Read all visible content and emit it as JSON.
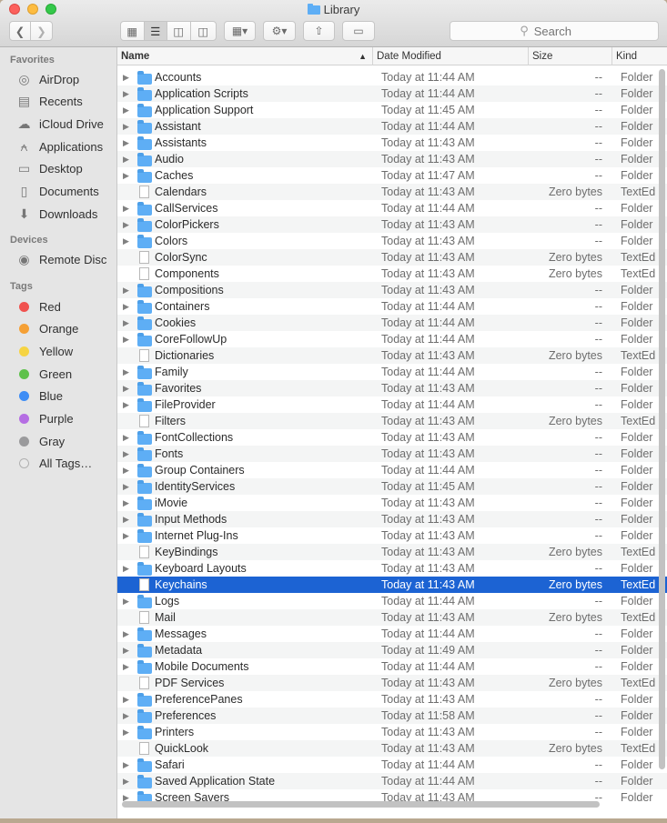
{
  "window": {
    "title": "Library"
  },
  "toolbar": {
    "view_icons": [
      "icon-view-icon",
      "list-view-icon",
      "column-view-icon",
      "cover-flow-icon"
    ],
    "search_placeholder": "Search"
  },
  "sidebar": {
    "favorites_header": "Favorites",
    "favorites": [
      {
        "label": "AirDrop",
        "icon": "airdrop-icon",
        "glyph": "◎"
      },
      {
        "label": "Recents",
        "icon": "recents-icon",
        "glyph": "▤"
      },
      {
        "label": "iCloud Drive",
        "icon": "cloud-icon",
        "glyph": "☁"
      },
      {
        "label": "Applications",
        "icon": "applications-icon",
        "glyph": "⍲"
      },
      {
        "label": "Desktop",
        "icon": "desktop-icon",
        "glyph": "▭"
      },
      {
        "label": "Documents",
        "icon": "documents-icon",
        "glyph": "▯"
      },
      {
        "label": "Downloads",
        "icon": "downloads-icon",
        "glyph": "⬇"
      }
    ],
    "devices_header": "Devices",
    "devices": [
      {
        "label": "Remote Disc",
        "icon": "disc-icon",
        "glyph": "◉"
      }
    ],
    "tags_header": "Tags",
    "tags": [
      {
        "label": "Red",
        "color": "#f0524f"
      },
      {
        "label": "Orange",
        "color": "#f5a035"
      },
      {
        "label": "Yellow",
        "color": "#f6d443"
      },
      {
        "label": "Green",
        "color": "#5ec14b"
      },
      {
        "label": "Blue",
        "color": "#3e8df5"
      },
      {
        "label": "Purple",
        "color": "#b56ee3"
      },
      {
        "label": "Gray",
        "color": "#9a9a9c"
      },
      {
        "label": "All Tags…",
        "color": "#e8e8e8"
      }
    ]
  },
  "columns": {
    "name": "Name",
    "date": "Date Modified",
    "size": "Size",
    "kind": "Kind"
  },
  "files": [
    {
      "name": "Accounts",
      "date": "Today at 11:44 AM",
      "size": "--",
      "kind": "Folder",
      "type": "folder"
    },
    {
      "name": "Application Scripts",
      "date": "Today at 11:44 AM",
      "size": "--",
      "kind": "Folder",
      "type": "folder"
    },
    {
      "name": "Application Support",
      "date": "Today at 11:45 AM",
      "size": "--",
      "kind": "Folder",
      "type": "folder"
    },
    {
      "name": "Assistant",
      "date": "Today at 11:44 AM",
      "size": "--",
      "kind": "Folder",
      "type": "folder"
    },
    {
      "name": "Assistants",
      "date": "Today at 11:43 AM",
      "size": "--",
      "kind": "Folder",
      "type": "folder"
    },
    {
      "name": "Audio",
      "date": "Today at 11:43 AM",
      "size": "--",
      "kind": "Folder",
      "type": "folder"
    },
    {
      "name": "Caches",
      "date": "Today at 11:47 AM",
      "size": "--",
      "kind": "Folder",
      "type": "folder"
    },
    {
      "name": "Calendars",
      "date": "Today at 11:43 AM",
      "size": "Zero bytes",
      "kind": "TextEd",
      "type": "doc"
    },
    {
      "name": "CallServices",
      "date": "Today at 11:44 AM",
      "size": "--",
      "kind": "Folder",
      "type": "folder"
    },
    {
      "name": "ColorPickers",
      "date": "Today at 11:43 AM",
      "size": "--",
      "kind": "Folder",
      "type": "folder"
    },
    {
      "name": "Colors",
      "date": "Today at 11:43 AM",
      "size": "--",
      "kind": "Folder",
      "type": "folder"
    },
    {
      "name": "ColorSync",
      "date": "Today at 11:43 AM",
      "size": "Zero bytes",
      "kind": "TextEd",
      "type": "doc"
    },
    {
      "name": "Components",
      "date": "Today at 11:43 AM",
      "size": "Zero bytes",
      "kind": "TextEd",
      "type": "doc"
    },
    {
      "name": "Compositions",
      "date": "Today at 11:43 AM",
      "size": "--",
      "kind": "Folder",
      "type": "folder"
    },
    {
      "name": "Containers",
      "date": "Today at 11:44 AM",
      "size": "--",
      "kind": "Folder",
      "type": "folder"
    },
    {
      "name": "Cookies",
      "date": "Today at 11:44 AM",
      "size": "--",
      "kind": "Folder",
      "type": "folder"
    },
    {
      "name": "CoreFollowUp",
      "date": "Today at 11:44 AM",
      "size": "--",
      "kind": "Folder",
      "type": "folder"
    },
    {
      "name": "Dictionaries",
      "date": "Today at 11:43 AM",
      "size": "Zero bytes",
      "kind": "TextEd",
      "type": "doc"
    },
    {
      "name": "Family",
      "date": "Today at 11:44 AM",
      "size": "--",
      "kind": "Folder",
      "type": "folder"
    },
    {
      "name": "Favorites",
      "date": "Today at 11:43 AM",
      "size": "--",
      "kind": "Folder",
      "type": "folder"
    },
    {
      "name": "FileProvider",
      "date": "Today at 11:44 AM",
      "size": "--",
      "kind": "Folder",
      "type": "folder"
    },
    {
      "name": "Filters",
      "date": "Today at 11:43 AM",
      "size": "Zero bytes",
      "kind": "TextEd",
      "type": "doc"
    },
    {
      "name": "FontCollections",
      "date": "Today at 11:43 AM",
      "size": "--",
      "kind": "Folder",
      "type": "folder"
    },
    {
      "name": "Fonts",
      "date": "Today at 11:43 AM",
      "size": "--",
      "kind": "Folder",
      "type": "folder"
    },
    {
      "name": "Group Containers",
      "date": "Today at 11:44 AM",
      "size": "--",
      "kind": "Folder",
      "type": "folder"
    },
    {
      "name": "IdentityServices",
      "date": "Today at 11:45 AM",
      "size": "--",
      "kind": "Folder",
      "type": "folder"
    },
    {
      "name": "iMovie",
      "date": "Today at 11:43 AM",
      "size": "--",
      "kind": "Folder",
      "type": "folder"
    },
    {
      "name": "Input Methods",
      "date": "Today at 11:43 AM",
      "size": "--",
      "kind": "Folder",
      "type": "folder"
    },
    {
      "name": "Internet Plug-Ins",
      "date": "Today at 11:43 AM",
      "size": "--",
      "kind": "Folder",
      "type": "folder"
    },
    {
      "name": "KeyBindings",
      "date": "Today at 11:43 AM",
      "size": "Zero bytes",
      "kind": "TextEd",
      "type": "doc"
    },
    {
      "name": "Keyboard Layouts",
      "date": "Today at 11:43 AM",
      "size": "--",
      "kind": "Folder",
      "type": "folder"
    },
    {
      "name": "Keychains",
      "date": "Today at 11:43 AM",
      "size": "Zero bytes",
      "kind": "TextEd",
      "type": "doc",
      "selected": true
    },
    {
      "name": "Logs",
      "date": "Today at 11:44 AM",
      "size": "--",
      "kind": "Folder",
      "type": "folder"
    },
    {
      "name": "Mail",
      "date": "Today at 11:43 AM",
      "size": "Zero bytes",
      "kind": "TextEd",
      "type": "doc"
    },
    {
      "name": "Messages",
      "date": "Today at 11:44 AM",
      "size": "--",
      "kind": "Folder",
      "type": "folder"
    },
    {
      "name": "Metadata",
      "date": "Today at 11:49 AM",
      "size": "--",
      "kind": "Folder",
      "type": "folder"
    },
    {
      "name": "Mobile Documents",
      "date": "Today at 11:44 AM",
      "size": "--",
      "kind": "Folder",
      "type": "folder"
    },
    {
      "name": "PDF Services",
      "date": "Today at 11:43 AM",
      "size": "Zero bytes",
      "kind": "TextEd",
      "type": "doc"
    },
    {
      "name": "PreferencePanes",
      "date": "Today at 11:43 AM",
      "size": "--",
      "kind": "Folder",
      "type": "folder"
    },
    {
      "name": "Preferences",
      "date": "Today at 11:58 AM",
      "size": "--",
      "kind": "Folder",
      "type": "folder"
    },
    {
      "name": "Printers",
      "date": "Today at 11:43 AM",
      "size": "--",
      "kind": "Folder",
      "type": "folder"
    },
    {
      "name": "QuickLook",
      "date": "Today at 11:43 AM",
      "size": "Zero bytes",
      "kind": "TextEd",
      "type": "doc"
    },
    {
      "name": "Safari",
      "date": "Today at 11:44 AM",
      "size": "--",
      "kind": "Folder",
      "type": "folder"
    },
    {
      "name": "Saved Application State",
      "date": "Today at 11:44 AM",
      "size": "--",
      "kind": "Folder",
      "type": "folder"
    },
    {
      "name": "Screen Savers",
      "date": "Today at 11:43 AM",
      "size": "--",
      "kind": "Folder",
      "type": "folder"
    }
  ]
}
